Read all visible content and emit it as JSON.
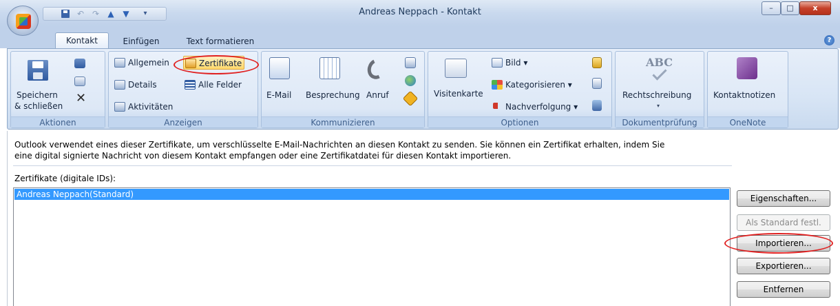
{
  "window": {
    "title": "Andreas Neppach - Kontakt",
    "controls": {
      "minimize": "–",
      "maximize": "□",
      "close": "x"
    }
  },
  "qat": {
    "undo": "↶",
    "redo": "↷",
    "up": "▲",
    "down": "▼",
    "customize": "▾"
  },
  "tabs": [
    "Kontakt",
    "Einfügen",
    "Text formatieren"
  ],
  "help": "?",
  "ribbon": {
    "aktionen": {
      "label": "Aktionen",
      "save_close": [
        "Speichern",
        "& schließen"
      ],
      "delete_glyph": "✕"
    },
    "anzeigen": {
      "label": "Anzeigen",
      "items": [
        "Allgemein",
        "Zertifikate",
        "Details",
        "Alle Felder",
        "Aktivitäten"
      ]
    },
    "kommunizieren": {
      "label": "Kommunizieren",
      "items": [
        "E-Mail",
        "Besprechung",
        "Anruf"
      ]
    },
    "optionen": {
      "label": "Optionen",
      "items": [
        "Visitenkarte",
        "Bild ▾",
        "Kategorisieren ▾",
        "Nachverfolgung ▾"
      ]
    },
    "dokumentpruefung": {
      "label": "Dokumentprüfung",
      "items": [
        "Rechtschreibung"
      ],
      "abc": "ABC"
    },
    "onenote": {
      "label": "OneNote",
      "items": [
        "Kontaktnotizen"
      ]
    }
  },
  "content": {
    "info_line1": "Outlook verwendet eines dieser Zertifikate, um verschlüsselte E-Mail-Nachrichten an diesen Kontakt zu senden. Sie können ein Zertifikat erhalten, indem Sie",
    "info_line2": "eine digital signierte Nachricht von diesem Kontakt empfangen oder eine Zertifikatdatei für diesen Kontakt importieren.",
    "list_label": "Zertifikate (digitale IDs):",
    "certificates": [
      "Andreas Neppach(Standard)"
    ],
    "buttons": {
      "properties": "Eigenschaften...",
      "set_default": "Als Standard festl.",
      "import": "Importieren...",
      "export": "Exportieren...",
      "remove": "Entfernen"
    }
  },
  "colors": {
    "selection": "#3399ff",
    "annotation": "#e02020",
    "ribbon_bg": "#dde8f6"
  }
}
